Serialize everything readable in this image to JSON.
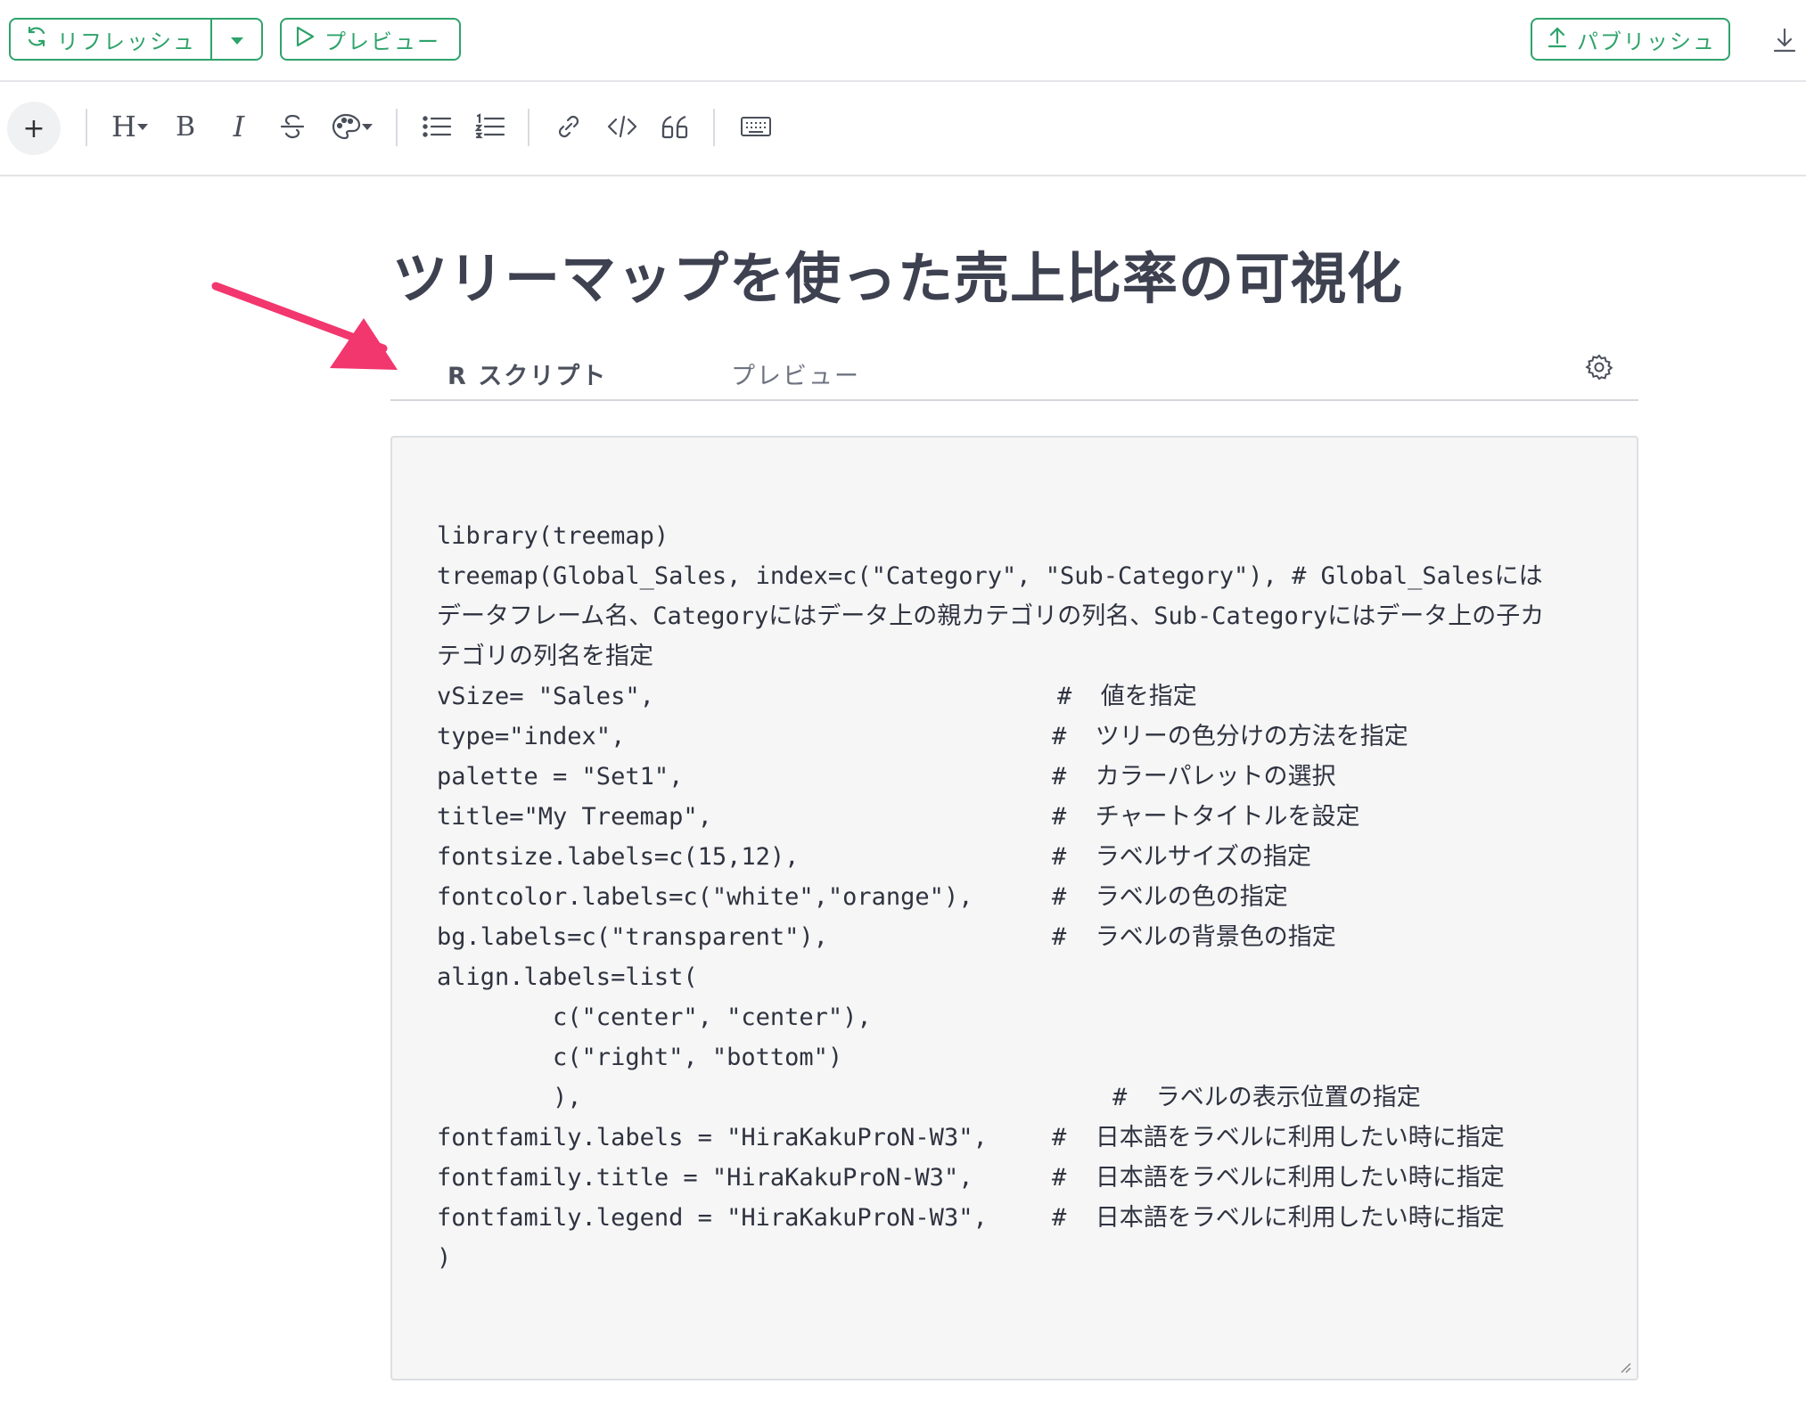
{
  "topbar": {
    "refresh_label": "リフレッシュ",
    "preview_label": "プレビュー",
    "publish_label": "パブリッシュ"
  },
  "toolbar": {
    "plus_label": "+",
    "heading_label": "H",
    "bold_label": "B",
    "italic_label": "I"
  },
  "document": {
    "title": "ツリーマップを使った売上比率の可視化"
  },
  "tabs": [
    {
      "label": "R スクリプト",
      "active": true
    },
    {
      "label": "プレビュー",
      "active": false
    }
  ],
  "editor": {
    "code": "library(treemap)\ntreemap(Global_Sales, index=c(\"Category\", \"Sub-Category\"), # Global_Salesには\nデータフレーム名、Categoryにはデータ上の親カテゴリの列名、Sub-Categoryにはデータ上の子カ\nテゴリの列名を指定\nvSize= \"Sales\",\ntype=\"index\",\npalette = \"Set1\",\ntitle=\"My Treemap\",\nfontsize.labels=c(15,12),\nfontcolor.labels=c(\"white\",\"orange\"),\nbg.labels=c(\"transparent\"),\nalign.labels=list(\n        c(\"center\", \"center\"),\n        c(\"right\", \"bottom\")\n        ),\nfontfamily.labels = \"HiraKakuProN-W3\",\nfontfamily.title = \"HiraKakuProN-W3\",\nfontfamily.legend = \"HiraKakuProN-W3\",\n)",
    "comments": [
      {
        "line": 4,
        "text": "#  値を指定",
        "indent": "wide"
      },
      {
        "line": 5,
        "text": "#  ツリーの色分けの方法を指定",
        "indent": "normal"
      },
      {
        "line": 6,
        "text": "#  カラーパレットの選択",
        "indent": "normal"
      },
      {
        "line": 7,
        "text": "#  チャートタイトルを設定",
        "indent": "normal"
      },
      {
        "line": 8,
        "text": "#  ラベルサイズの指定",
        "indent": "normal"
      },
      {
        "line": 9,
        "text": "#  ラベルの色の指定",
        "indent": "normal"
      },
      {
        "line": 10,
        "text": "#  ラベルの背景色の指定",
        "indent": "normal"
      },
      {
        "line": 14,
        "text": "#  ラベルの表示位置の指定",
        "indent": "far"
      },
      {
        "line": 15,
        "text": "#  日本語をラベルに利用したい時に指定",
        "indent": "normal"
      },
      {
        "line": 16,
        "text": "#  日本語をラベルに利用したい時に指定",
        "indent": "normal"
      },
      {
        "line": 17,
        "text": "#  日本語をラベルに利用したい時に指定",
        "indent": "normal"
      }
    ]
  },
  "colors": {
    "accent": "#2ea36b",
    "annotation_arrow": "#f2366e"
  }
}
